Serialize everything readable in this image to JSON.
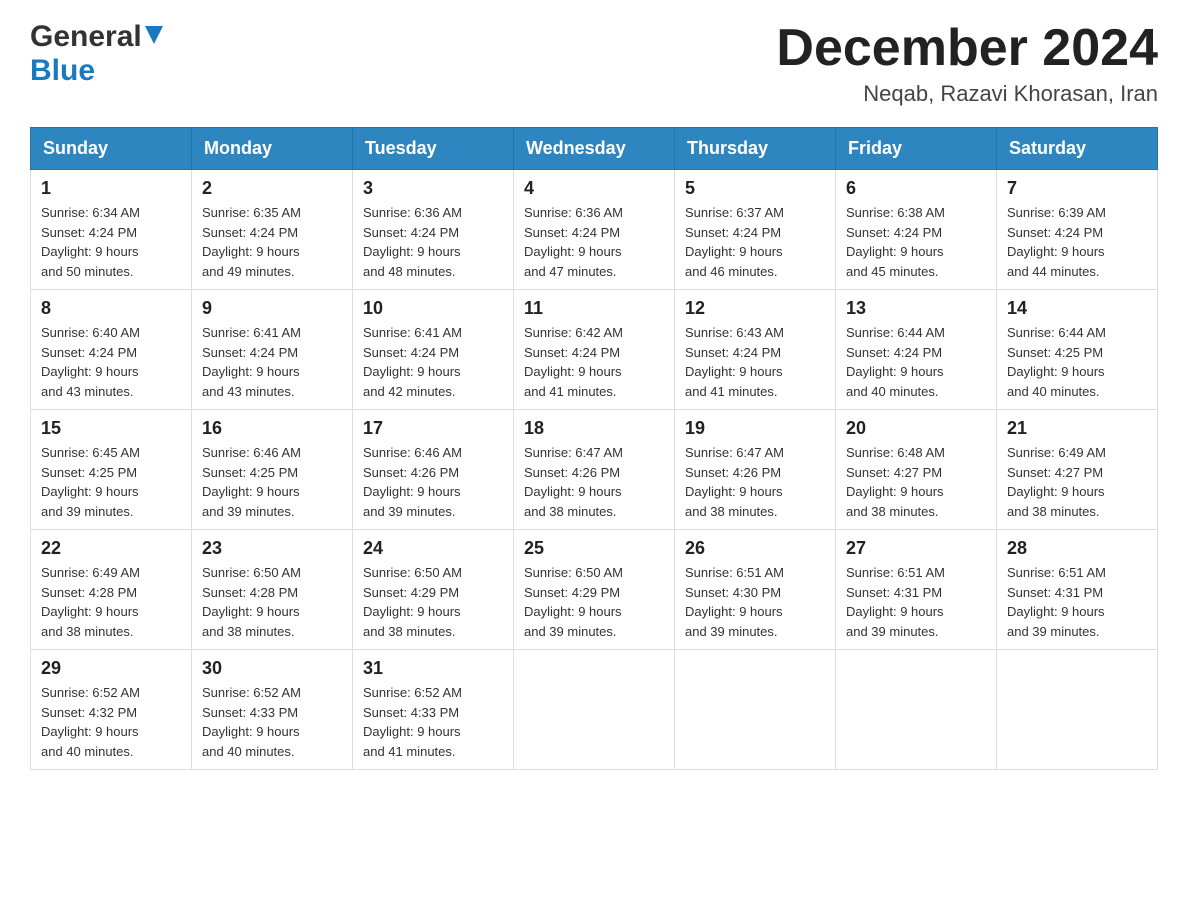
{
  "header": {
    "logo_general": "General",
    "logo_blue": "Blue",
    "title": "December 2024",
    "subtitle": "Neqab, Razavi Khorasan, Iran"
  },
  "weekdays": [
    "Sunday",
    "Monday",
    "Tuesday",
    "Wednesday",
    "Thursday",
    "Friday",
    "Saturday"
  ],
  "weeks": [
    [
      {
        "day": "1",
        "sunrise": "6:34 AM",
        "sunset": "4:24 PM",
        "daylight": "9 hours and 50 minutes."
      },
      {
        "day": "2",
        "sunrise": "6:35 AM",
        "sunset": "4:24 PM",
        "daylight": "9 hours and 49 minutes."
      },
      {
        "day": "3",
        "sunrise": "6:36 AM",
        "sunset": "4:24 PM",
        "daylight": "9 hours and 48 minutes."
      },
      {
        "day": "4",
        "sunrise": "6:36 AM",
        "sunset": "4:24 PM",
        "daylight": "9 hours and 47 minutes."
      },
      {
        "day": "5",
        "sunrise": "6:37 AM",
        "sunset": "4:24 PM",
        "daylight": "9 hours and 46 minutes."
      },
      {
        "day": "6",
        "sunrise": "6:38 AM",
        "sunset": "4:24 PM",
        "daylight": "9 hours and 45 minutes."
      },
      {
        "day": "7",
        "sunrise": "6:39 AM",
        "sunset": "4:24 PM",
        "daylight": "9 hours and 44 minutes."
      }
    ],
    [
      {
        "day": "8",
        "sunrise": "6:40 AM",
        "sunset": "4:24 PM",
        "daylight": "9 hours and 43 minutes."
      },
      {
        "day": "9",
        "sunrise": "6:41 AM",
        "sunset": "4:24 PM",
        "daylight": "9 hours and 43 minutes."
      },
      {
        "day": "10",
        "sunrise": "6:41 AM",
        "sunset": "4:24 PM",
        "daylight": "9 hours and 42 minutes."
      },
      {
        "day": "11",
        "sunrise": "6:42 AM",
        "sunset": "4:24 PM",
        "daylight": "9 hours and 41 minutes."
      },
      {
        "day": "12",
        "sunrise": "6:43 AM",
        "sunset": "4:24 PM",
        "daylight": "9 hours and 41 minutes."
      },
      {
        "day": "13",
        "sunrise": "6:44 AM",
        "sunset": "4:24 PM",
        "daylight": "9 hours and 40 minutes."
      },
      {
        "day": "14",
        "sunrise": "6:44 AM",
        "sunset": "4:25 PM",
        "daylight": "9 hours and 40 minutes."
      }
    ],
    [
      {
        "day": "15",
        "sunrise": "6:45 AM",
        "sunset": "4:25 PM",
        "daylight": "9 hours and 39 minutes."
      },
      {
        "day": "16",
        "sunrise": "6:46 AM",
        "sunset": "4:25 PM",
        "daylight": "9 hours and 39 minutes."
      },
      {
        "day": "17",
        "sunrise": "6:46 AM",
        "sunset": "4:26 PM",
        "daylight": "9 hours and 39 minutes."
      },
      {
        "day": "18",
        "sunrise": "6:47 AM",
        "sunset": "4:26 PM",
        "daylight": "9 hours and 38 minutes."
      },
      {
        "day": "19",
        "sunrise": "6:47 AM",
        "sunset": "4:26 PM",
        "daylight": "9 hours and 38 minutes."
      },
      {
        "day": "20",
        "sunrise": "6:48 AM",
        "sunset": "4:27 PM",
        "daylight": "9 hours and 38 minutes."
      },
      {
        "day": "21",
        "sunrise": "6:49 AM",
        "sunset": "4:27 PM",
        "daylight": "9 hours and 38 minutes."
      }
    ],
    [
      {
        "day": "22",
        "sunrise": "6:49 AM",
        "sunset": "4:28 PM",
        "daylight": "9 hours and 38 minutes."
      },
      {
        "day": "23",
        "sunrise": "6:50 AM",
        "sunset": "4:28 PM",
        "daylight": "9 hours and 38 minutes."
      },
      {
        "day": "24",
        "sunrise": "6:50 AM",
        "sunset": "4:29 PM",
        "daylight": "9 hours and 38 minutes."
      },
      {
        "day": "25",
        "sunrise": "6:50 AM",
        "sunset": "4:29 PM",
        "daylight": "9 hours and 39 minutes."
      },
      {
        "day": "26",
        "sunrise": "6:51 AM",
        "sunset": "4:30 PM",
        "daylight": "9 hours and 39 minutes."
      },
      {
        "day": "27",
        "sunrise": "6:51 AM",
        "sunset": "4:31 PM",
        "daylight": "9 hours and 39 minutes."
      },
      {
        "day": "28",
        "sunrise": "6:51 AM",
        "sunset": "4:31 PM",
        "daylight": "9 hours and 39 minutes."
      }
    ],
    [
      {
        "day": "29",
        "sunrise": "6:52 AM",
        "sunset": "4:32 PM",
        "daylight": "9 hours and 40 minutes."
      },
      {
        "day": "30",
        "sunrise": "6:52 AM",
        "sunset": "4:33 PM",
        "daylight": "9 hours and 40 minutes."
      },
      {
        "day": "31",
        "sunrise": "6:52 AM",
        "sunset": "4:33 PM",
        "daylight": "9 hours and 41 minutes."
      },
      null,
      null,
      null,
      null
    ]
  ],
  "labels": {
    "sunrise": "Sunrise:",
    "sunset": "Sunset:",
    "daylight": "Daylight:"
  }
}
